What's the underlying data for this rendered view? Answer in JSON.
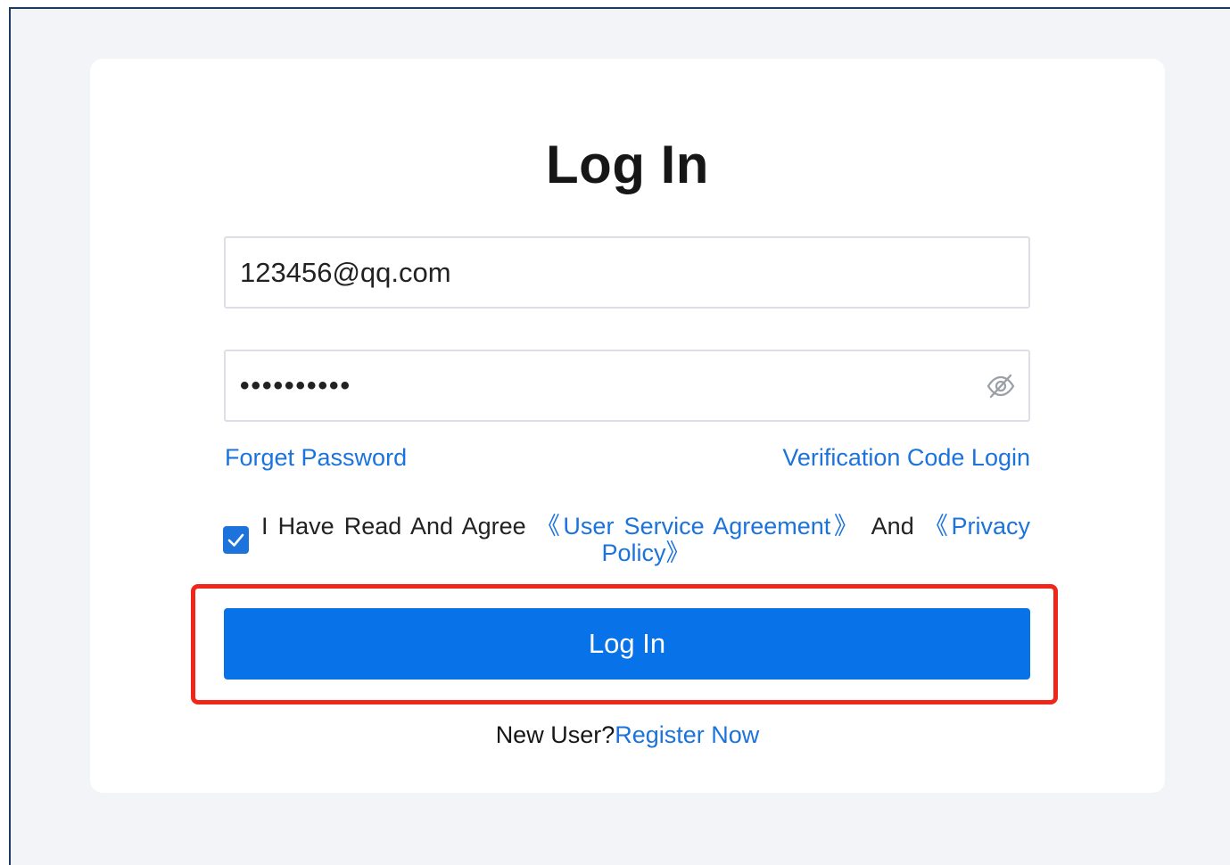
{
  "page": {
    "title": "Log In"
  },
  "form": {
    "email_value": "123456@qq.com",
    "password_value": "••••••••••",
    "password_toggle_icon": "eye-off-icon"
  },
  "links": {
    "forget_password": "Forget Password",
    "verification_code_login": "Verification Code Login"
  },
  "agreement": {
    "checked": true,
    "prefix": "I Have Read And Agree",
    "user_service": "《User Service Agreement》",
    "conjunction": "And",
    "privacy_policy": "《Privacy Policy》"
  },
  "login_button_label": "Log In",
  "register": {
    "prompt": "New User?",
    "link": "Register Now"
  },
  "colors": {
    "accent": "#0873e8",
    "link": "#1b73db",
    "highlight": "#f0261b",
    "background": "#f2f4f7"
  }
}
